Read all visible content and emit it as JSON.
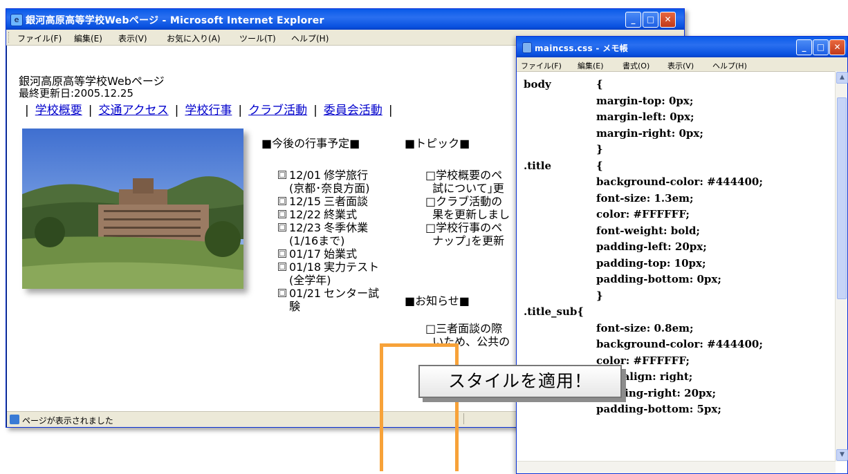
{
  "ie": {
    "title": "銀河高原高等学校Webページ - Microsoft Internet Explorer",
    "menu": [
      "ファイル(F)",
      "編集(E)",
      "表示(V)",
      "お気に入り(A)",
      "ツール(T)",
      "ヘルプ(H)"
    ],
    "page": {
      "site_title": "銀河高原高等学校Webページ",
      "last_updated": "最終更新日:2005.12.25",
      "nav": [
        "学校概要",
        "交通アクセス",
        "学校行事",
        "クラブ活動",
        "委員会活動"
      ],
      "events_heading": "■今後の行事予定■",
      "topics_heading": "■トピック■",
      "notice_heading": "■お知らせ■",
      "events": [
        {
          "date": "12/01",
          "text": "修学旅行",
          "sub": "(京都･奈良方面)"
        },
        {
          "date": "12/15",
          "text": "三者面談",
          "sub": ""
        },
        {
          "date": "12/22",
          "text": "終業式",
          "sub": ""
        },
        {
          "date": "12/23",
          "text": "冬季休業",
          "sub": "(1/16まで)"
        },
        {
          "date": "01/17",
          "text": "始業式",
          "sub": ""
        },
        {
          "date": "01/18",
          "text": "実力テスト",
          "sub": "(全学年)"
        },
        {
          "date": "01/21",
          "text": "センター試",
          "sub": "験"
        }
      ],
      "topics": [
        {
          "line1": "□学校概要のペ",
          "line2": "試について｣更"
        },
        {
          "line1": "□クラブ活動の",
          "line2": "果を更新しまし"
        },
        {
          "line1": "□学校行事のペ",
          "line2": "ナップ｣を更新"
        }
      ],
      "notice": {
        "line1": "□三者面談の際",
        "line2": "いため、公共の"
      }
    },
    "status": "ページが表示されました"
  },
  "notepad": {
    "title": "maincss.css - メモ帳",
    "menu": [
      "ファイル(F)",
      "編集(E)",
      "書式(O)",
      "表示(V)",
      "ヘルプ(H)"
    ],
    "lines": [
      {
        "kind": "sel",
        "text": "body"
      },
      {
        "kind": "brace",
        "text": "{"
      },
      {
        "kind": "prop",
        "text": "margin-top: 0px;"
      },
      {
        "kind": "prop",
        "text": "margin-left: 0px;"
      },
      {
        "kind": "prop",
        "text": "margin-right: 0px;"
      },
      {
        "kind": "brace",
        "text": "}"
      },
      {
        "kind": "sel",
        "text": ".title"
      },
      {
        "kind": "brace",
        "text": "{"
      },
      {
        "kind": "prop",
        "text": "background-color: #444400;"
      },
      {
        "kind": "prop",
        "text": "font-size: 1.3em;"
      },
      {
        "kind": "prop",
        "text": "color: #FFFFFF;"
      },
      {
        "kind": "prop",
        "text": "font-weight: bold;"
      },
      {
        "kind": "prop",
        "text": "padding-left: 20px;"
      },
      {
        "kind": "prop",
        "text": "padding-top: 10px;"
      },
      {
        "kind": "prop",
        "text": "padding-bottom: 0px;"
      },
      {
        "kind": "brace",
        "text": "}"
      },
      {
        "kind": "sel",
        "text": ".title_sub{"
      },
      {
        "kind": "prop",
        "text": "font-size: 0.8em;"
      },
      {
        "kind": "prop",
        "text": "background-color: #444400;"
      },
      {
        "kind": "prop",
        "text": "color: #FFFFFF;"
      },
      {
        "kind": "prop",
        "text": "text-align: right;"
      },
      {
        "kind": "prop",
        "text": "padding-right: 20px;"
      },
      {
        "kind": "prop",
        "text": "padding-bottom: 5px;"
      }
    ]
  },
  "callout": "スタイルを適用！",
  "colors": {
    "accent_orange": "#f7a239",
    "link": "#0000cc",
    "xp_blue": "#0a5ae8"
  }
}
